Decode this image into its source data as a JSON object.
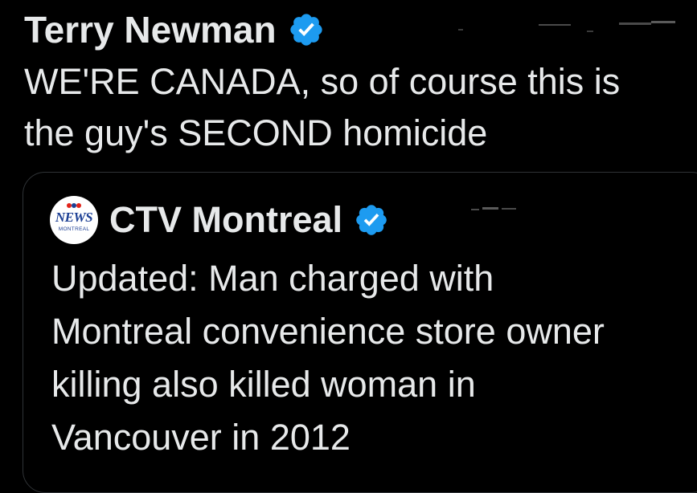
{
  "colors": {
    "background": "#000000",
    "text": "#e7e9ea",
    "verified_blue": "#1d9bf0",
    "card_border": "#2f3336"
  },
  "tweet": {
    "author_name": "Terry Newman",
    "verified_icon": "verified-badge-icon",
    "text": "WE'RE CANADA, so of course this is\nthe guy's SECOND homicide"
  },
  "quote": {
    "avatar_logo_text": "NEWS",
    "avatar_logo_subtext": "MONTREAL",
    "author_name": "CTV Montreal",
    "verified_icon": "verified-badge-icon",
    "text": "Updated: Man charged with\nMontreal convenience store owner\nkilling also killed woman in\nVancouver in 2012"
  }
}
